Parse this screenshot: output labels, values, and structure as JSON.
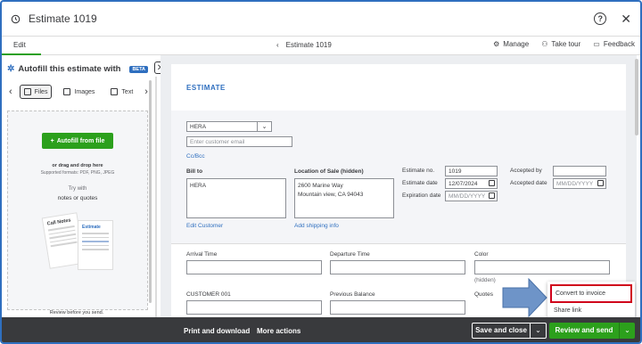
{
  "window": {
    "title": "Estimate 1019"
  },
  "subbar": {
    "edit_tab": "Edit",
    "center_title": "Estimate 1019",
    "manage": "Manage",
    "take_tour": "Take tour",
    "feedback": "Feedback"
  },
  "left_panel": {
    "title": "Autofill this estimate with",
    "beta": "BETA",
    "tabs": [
      "Files",
      "Images",
      "Text"
    ],
    "autofill_button": "Autofill from file",
    "drag_text": "or drag and drop here",
    "supported": "Supported formats: PDF, PNG, JPEG",
    "try_with": "Try with",
    "notes_quotes": "notes or quotes",
    "note_card_title": "Call Notes",
    "estimate_card_title": "Estimate",
    "review_text": "Review before you send."
  },
  "form": {
    "doc_title": "ESTIMATE",
    "customer_value": "HERA",
    "email_placeholder": "Enter customer email",
    "cc_bcc": "Cc/Bcc",
    "bill_to_label": "Bill to",
    "bill_to_value": "HERA",
    "location_label": "Location of Sale (hidden)",
    "location_line1": "2600 Marine Way",
    "location_line2": "Mountain view, CA 94043",
    "edit_customer": "Edit Customer",
    "add_shipping": "Add shipping info",
    "estimate_no_label": "Estimate no.",
    "estimate_no_value": "1019",
    "estimate_date_label": "Estimate date",
    "estimate_date_value": "12/07/2024",
    "expiration_label": "Expiration date",
    "expiration_placeholder": "MM/DD/YYYY",
    "accepted_by_label": "Accepted by",
    "accepted_date_label": "Accepted date",
    "accepted_date_placeholder": "MM/DD/YYYY",
    "arrival_time": "Arrival Time",
    "departure_time": "Departure Time",
    "color": "Color",
    "hidden_note": "(hidden)",
    "customer_001": "CUSTOMER 001",
    "previous_balance": "Previous Balance",
    "quotes": "Quotes"
  },
  "popup_menu": {
    "convert": "Convert to invoice",
    "share": "Share link"
  },
  "bottom_bar": {
    "print_download": "Print and download",
    "more_actions": "More actions",
    "save_close": "Save and close",
    "review_send": "Review and send"
  },
  "colors": {
    "brand_green": "#2ca01c",
    "link_blue": "#2f6fbf",
    "highlight_red": "#d0021b",
    "arrow_blue": "#6e94c8"
  }
}
